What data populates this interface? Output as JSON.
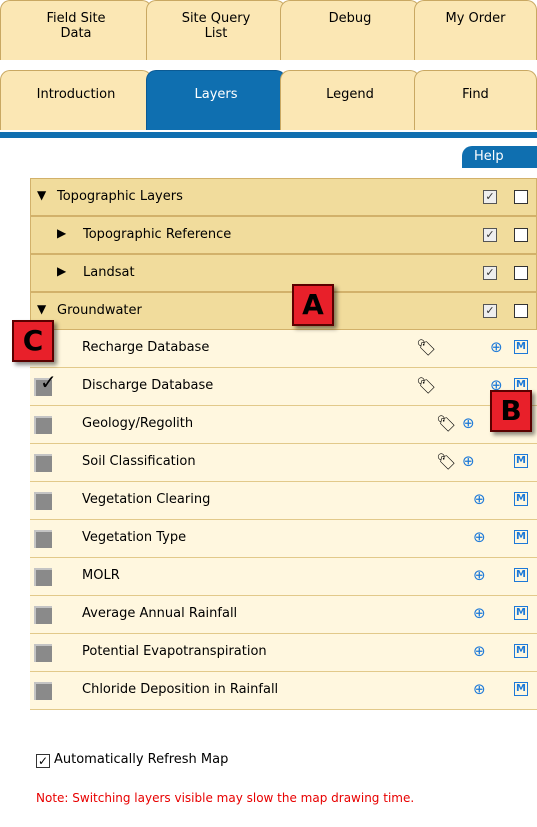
{
  "tabs_row1": [
    {
      "label_line1": "Field Site",
      "label_line2": "Data"
    },
    {
      "label_line1": "Site Query",
      "label_line2": "List"
    },
    {
      "label_line1": "Debug",
      "label_line2": ""
    },
    {
      "label_line1": "My Order",
      "label_line2": ""
    }
  ],
  "tabs_row2": [
    {
      "label": "Introduction",
      "active": false
    },
    {
      "label": "Layers",
      "active": true
    },
    {
      "label": "Legend",
      "active": false
    },
    {
      "label": "Find",
      "active": false
    }
  ],
  "help_label": "Help",
  "groups": {
    "topographic": "Topographic Layers",
    "topographic_reference": "Topographic Reference",
    "landsat": "Landsat",
    "groundwater": "Groundwater"
  },
  "layers": [
    {
      "label": "Recharge Database",
      "tag": true,
      "plus": true,
      "m": true
    },
    {
      "label": "Discharge Database",
      "tag": true,
      "plus": true,
      "m": true,
      "checked": true
    },
    {
      "label": "Geology/Regolith",
      "tag": true,
      "plus": true,
      "m": true
    },
    {
      "label": "Soil Classification",
      "tag": true,
      "plus": true,
      "m": true
    },
    {
      "label": "Vegetation Clearing",
      "tag": false,
      "plus": true,
      "m": true
    },
    {
      "label": "Vegetation Type",
      "tag": false,
      "plus": true,
      "m": true
    },
    {
      "label": "MOLR",
      "tag": false,
      "plus": true,
      "m": true
    },
    {
      "label": "Average Annual Rainfall",
      "tag": false,
      "plus": true,
      "m": true
    },
    {
      "label": "Potential Evapotranspiration",
      "tag": false,
      "plus": true,
      "m": true
    },
    {
      "label": "Chloride Deposition in Rainfall",
      "tag": false,
      "plus": true,
      "m": true
    }
  ],
  "callouts": {
    "a": "A",
    "b": "B",
    "c": "C"
  },
  "auto_refresh_label": "Automatically Refresh Map",
  "note": "Note: Switching layers visible may slow the map drawing time.",
  "colors": {
    "tab_active": "#0f6fb0",
    "tab_bg": "#fbe7b4",
    "group_bg": "#f1dc9c",
    "item_bg": "#fff7df",
    "note": "#e80000",
    "callout": "#e8202a"
  }
}
